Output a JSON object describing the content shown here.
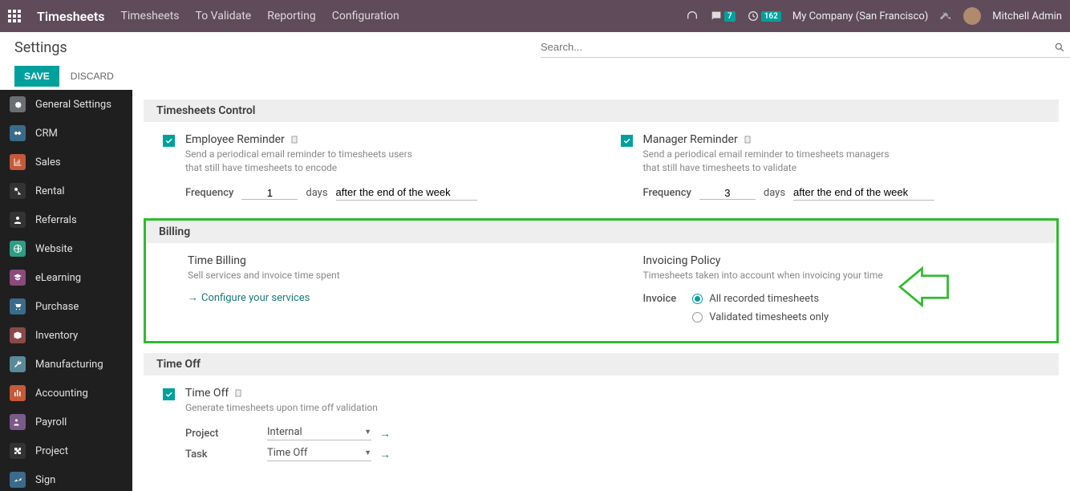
{
  "topbar": {
    "app_name": "Timesheets",
    "menus": [
      "Timesheets",
      "To Validate",
      "Reporting",
      "Configuration"
    ],
    "msg_badge": "7",
    "activity_badge": "162",
    "company": "My Company (San Francisco)",
    "user": "Mitchell Admin"
  },
  "header": {
    "title": "Settings",
    "search_placeholder": "Search..."
  },
  "actions": {
    "save": "SAVE",
    "discard": "DISCARD"
  },
  "sidebar": {
    "items": [
      {
        "label": "General Settings",
        "color": "#6b6e72"
      },
      {
        "label": "CRM",
        "color": "#3a6b8a"
      },
      {
        "label": "Sales",
        "color": "#c45a3a"
      },
      {
        "label": "Rental",
        "color": "#333"
      },
      {
        "label": "Referrals",
        "color": "#333"
      },
      {
        "label": "Website",
        "color": "#2c9e84"
      },
      {
        "label": "eLearning",
        "color": "#8a4a7a"
      },
      {
        "label": "Purchase",
        "color": "#3a6b8a"
      },
      {
        "label": "Inventory",
        "color": "#8a4a4a"
      },
      {
        "label": "Manufacturing",
        "color": "#5a8a9a"
      },
      {
        "label": "Accounting",
        "color": "#c45a3a"
      },
      {
        "label": "Payroll",
        "color": "#7a5a8a"
      },
      {
        "label": "Project",
        "color": "#333"
      },
      {
        "label": "Sign",
        "color": "#3a6b8a"
      }
    ]
  },
  "sections": {
    "control": {
      "title": "Timesheets Control",
      "employee": {
        "title": "Employee Reminder",
        "desc1": "Send a periodical email reminder to timesheets users",
        "desc2": "that still have timesheets to encode",
        "freq_label": "Frequency",
        "freq_value": "1",
        "unit": "days",
        "relative": "after the end of the week"
      },
      "manager": {
        "title": "Manager Reminder",
        "desc1": "Send a periodical email reminder to timesheets managers",
        "desc2": "that still have timesheets to validate",
        "freq_label": "Frequency",
        "freq_value": "3",
        "unit": "days",
        "relative": "after the end of the week"
      }
    },
    "billing": {
      "title": "Billing",
      "time_billing": {
        "title": "Time Billing",
        "desc": "Sell services and invoice time spent",
        "link": "Configure your services"
      },
      "invoicing": {
        "title": "Invoicing Policy",
        "desc": "Timesheets taken into account when invoicing your time",
        "label": "Invoice",
        "opt1": "All recorded timesheets",
        "opt2": "Validated timesheets only"
      }
    },
    "timeoff": {
      "title": "Time Off",
      "block": {
        "title": "Time Off",
        "desc": "Generate timesheets upon time off validation",
        "project_label": "Project",
        "project_value": "Internal",
        "task_label": "Task",
        "task_value": "Time Off"
      }
    }
  }
}
